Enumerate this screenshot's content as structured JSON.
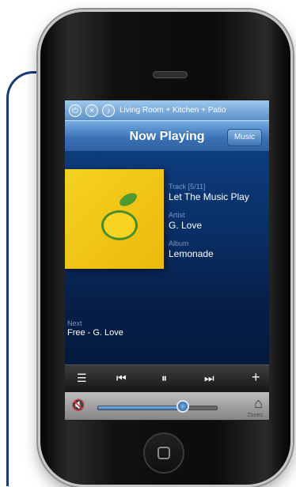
{
  "rooms": {
    "label": "Living Room + Kitchen + Patio",
    "icons": [
      "power-icon",
      "close-icon",
      "speaker-icon"
    ]
  },
  "header": {
    "title": "Now Playing",
    "music_button": "Music"
  },
  "track": {
    "label": "Track [5/11]",
    "title": "Let The Music Play"
  },
  "artist": {
    "label": "Artist",
    "name": "G. Love"
  },
  "album": {
    "label": "Album",
    "name": "Lemonade"
  },
  "next": {
    "label": "Next",
    "value": "Free - G. Love"
  },
  "transport": {
    "queue_icon": "☰",
    "prev_icon": "⏮",
    "pause_icon": "⏸",
    "next_icon": "⏭",
    "add_icon": "+"
  },
  "volume": {
    "mute_icon": "🔇",
    "level": 0.72,
    "zone_icon": "⌂",
    "zone_label": "Zones"
  },
  "colors": {
    "accent": "#3a72b6",
    "background": "#06112b"
  }
}
